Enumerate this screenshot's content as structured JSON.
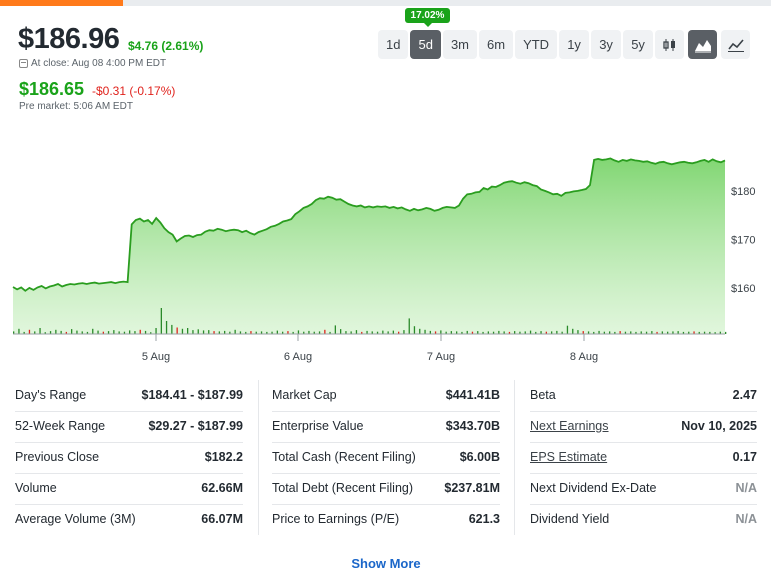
{
  "quote": {
    "price": "$186.96",
    "change": "$4.76 (2.61%)",
    "close_label": "At close: Aug 08 4:00 PM EDT",
    "premarket_price": "$186.65",
    "premarket_change": "-$0.31 (-0.17%)",
    "premarket_label": "Pre market: 5:06 AM EDT"
  },
  "range_buttons": [
    "1d",
    "5d",
    "3m",
    "6m",
    "YTD",
    "1y",
    "3y",
    "5y"
  ],
  "active_range": "5d",
  "range_tooltip": "17.02%",
  "chart_type_buttons": [
    {
      "icon": "candlestick-chart-icon",
      "active": false
    },
    {
      "icon": "mountain-chart-icon",
      "active": true
    },
    {
      "icon": "line-chart-icon",
      "active": false
    }
  ],
  "colors": {
    "up": "#1aa31a",
    "down": "#e0221c",
    "line": "#2a9d1f",
    "accent": "#ff7a1a",
    "link": "#1a66c9"
  },
  "chart_data": {
    "type": "area",
    "y_ticks": [
      "$180",
      "$170",
      "$160"
    ],
    "x_ticks": [
      "5 Aug",
      "6 Aug",
      "7 Aug",
      "8 Aug"
    ],
    "ylim": [
      150.5,
      190.5
    ],
    "series": [
      {
        "values": [
          160.2,
          159.7,
          160.1,
          159.4,
          160.0,
          159.6,
          160.1,
          160.4,
          159.9,
          160.3,
          160.5,
          160.8,
          160.3,
          160.6,
          160.8,
          160.7,
          160.9,
          161.0,
          160.8,
          161.0,
          161.1,
          160.9,
          161.0,
          161.1,
          161.2,
          161.0,
          161.2,
          161.3,
          161.2,
          173.1,
          174.0,
          174.3,
          173.7,
          174.0,
          173.2,
          174.4,
          173.5,
          172.3,
          171.5,
          171.0,
          169.6,
          170.2,
          170.7,
          170.8,
          170.5,
          170.9,
          171.0,
          171.6,
          171.9,
          171.8,
          172.2,
          172.0,
          171.7,
          171.9,
          172.0,
          171.9,
          171.5,
          171.8,
          171.3,
          171.0,
          171.5,
          171.8,
          172.1,
          172.6,
          172.8,
          173.2,
          173.7,
          173.9,
          174.2,
          175.2,
          175.8,
          176.5,
          176.8,
          177.3,
          178.1,
          178.5,
          178.4,
          178.8,
          178.6,
          178.2,
          178.3,
          177.8,
          177.3,
          177.0,
          176.8,
          177.0,
          176.6,
          176.8,
          176.6,
          176.8,
          176.7,
          176.8,
          176.5,
          176.7,
          176.4,
          176.6,
          176.2,
          175.9,
          176.3,
          176.0,
          176.2,
          176.5,
          176.3,
          175.9,
          176.1,
          176.5,
          176.7,
          176.6,
          176.5,
          177.0,
          178.4,
          179.3,
          179.4,
          179.7,
          179.8,
          180.6,
          180.3,
          180.9,
          180.8,
          181.2,
          181.7,
          181.9,
          182.0,
          181.7,
          181.5,
          181.8,
          181.6,
          181.2,
          181.0,
          180.3,
          180.0,
          179.7,
          179.3,
          179.4,
          179.0,
          179.6,
          179.7,
          179.9,
          180.0,
          180.2,
          180.4,
          181.2,
          186.4,
          186.6,
          186.4,
          186.5,
          186.7,
          186.3,
          186.0,
          186.4,
          186.2,
          186.5,
          186.3,
          186.2,
          186.0,
          186.1,
          185.8,
          185.6,
          185.9,
          186.0,
          185.7,
          185.5,
          185.7,
          185.9,
          186.0,
          185.8,
          185.7,
          185.9,
          186.2,
          186.4,
          186.0,
          186.5,
          186.1,
          185.9,
          186.3
        ]
      }
    ],
    "volume": [
      1,
      2,
      0.8,
      1.6,
      1.0,
      2.3,
      0.7,
      1.1,
      1.6,
      1.2,
      0.8,
      1.9,
      1.3,
      1.0,
      0.8,
      2.0,
      1.3,
      0.9,
      1.1,
      1.5,
      1.0,
      0.9,
      1.4,
      1.1,
      1.6,
      1.2,
      0.7,
      2.3,
      10,
      5,
      3.5,
      2.5,
      2,
      2.3,
      1.5,
      1.8,
      1.4,
      1.5,
      1.1,
      1,
      1.2,
      0.9,
      1.6,
      1,
      0.8,
      1.1,
      0.9,
      1,
      0.8,
      0.9,
      1.3,
      0.9,
      1.1,
      0.8,
      1.4,
      0.9,
      1.2,
      0.9,
      1.0,
      1.6,
      0.8,
      3.3,
      1.9,
      1.1,
      1.0,
      1.5,
      0.8,
      1.2,
      1.0,
      0.9,
      1.3,
      1.0,
      1.3,
      0.9,
      1.5,
      6,
      3,
      2,
      1.6,
      1.2,
      1.0,
      1.4,
      0.9,
      1.1,
      1.0,
      0.8,
      1.2,
      0.9,
      1.1,
      0.8,
      1.0,
      0.9,
      1.2,
      1.0,
      0.8,
      1.1,
      0.9,
      1.0,
      1.3,
      0.8,
      1.1,
      0.9,
      1.0,
      1.2,
      0.9,
      3.2,
      2.0,
      1.5,
      1.1,
      1.0,
      0.8,
      1.2,
      0.9,
      1.0,
      0.8,
      1.1,
      0.9,
      1.0,
      0.8,
      1.0,
      0.9,
      1.1,
      0.8,
      1.0,
      0.9,
      1.0,
      1.1,
      0.8,
      0.9,
      1.0,
      0.8,
      0.9,
      0.8,
      0.7,
      0.9,
      0.8
    ]
  },
  "stats": {
    "col1": [
      {
        "label": "Day's Range",
        "value": "$184.41 - $187.99"
      },
      {
        "label": "52-Week Range",
        "value": "$29.27 - $187.99"
      },
      {
        "label": "Previous Close",
        "value": "$182.2"
      },
      {
        "label": "Volume",
        "value": "62.66M"
      },
      {
        "label": "Average Volume (3M)",
        "value": "66.07M"
      }
    ],
    "col2": [
      {
        "label": "Market Cap",
        "value": "$441.41B"
      },
      {
        "label": "Enterprise Value",
        "value": "$343.70B"
      },
      {
        "label": "Total Cash (Recent Filing)",
        "value": "$6.00B"
      },
      {
        "label": "Total Debt (Recent Filing)",
        "value": "$237.81M"
      },
      {
        "label": "Price to Earnings (P/E)",
        "value": "621.3"
      }
    ],
    "col3": [
      {
        "label": "Beta",
        "value": "2.47"
      },
      {
        "label": "Next Earnings",
        "value": "Nov 10, 2025"
      },
      {
        "label": "EPS Estimate",
        "value": "0.17"
      },
      {
        "label": "Next Dividend Ex-Date",
        "value": "N/A"
      },
      {
        "label": "Dividend Yield",
        "value": "N/A"
      }
    ]
  },
  "show_more": "Show More"
}
